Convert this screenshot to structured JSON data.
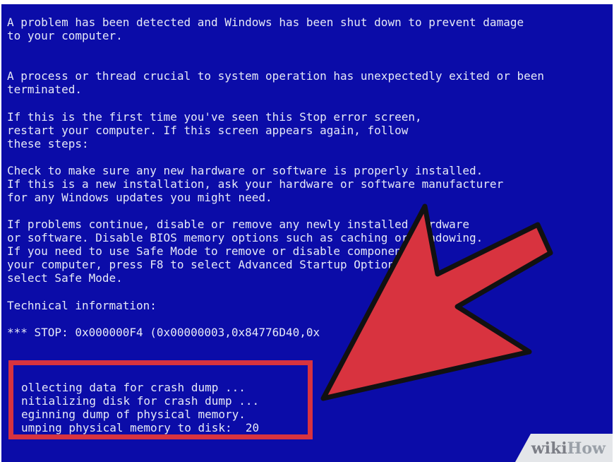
{
  "bsod": {
    "lines": [
      "A problem has been detected and Windows has been shut down to prevent damage",
      "to your computer.",
      "A process or thread crucial to system operation has unexpectedly exited or been",
      "terminated.",
      "If this is the first time you've seen this Stop error screen,",
      "restart your computer. If this screen appears again, follow",
      "these steps:",
      "Check to make sure any new hardware or software is properly installed.",
      "If this is a new installation, ask your hardware or software manufacturer",
      "for any Windows updates you might need.",
      "If problems continue, disable or remove any newly installed hardware",
      "or software. Disable BIOS memory options such as caching or shadowing.",
      "If you need to use Safe Mode to remove or disable components,",
      "your computer, press F8 to select Advanced Startup Options,",
      "select Safe Mode.",
      "Technical information:",
      "*** STOP: 0x000000F4 (0x00000003,0x84776D40,0x"
    ],
    "dump_lines": [
      "ollecting data for crash dump ...",
      "nitializing disk for crash dump ...",
      "eginning dump of physical memory.",
      "umping physical memory to disk:  20"
    ]
  },
  "colors": {
    "background": "#0b0ca8",
    "text": "#e6e9f7",
    "highlight": "#d8333f",
    "arrow": "#d8333f",
    "arrow_outline": "#111111"
  },
  "watermark": {
    "prefix": "wiki",
    "suffix": "How"
  }
}
